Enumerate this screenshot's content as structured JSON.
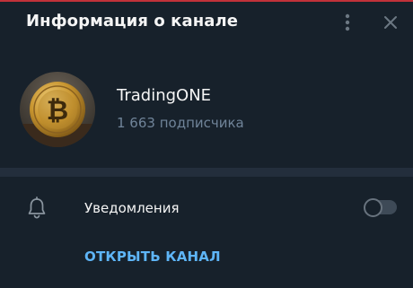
{
  "header": {
    "title": "Информация о канале",
    "menu_icon": "more-vertical-icon",
    "close_icon": "close-icon"
  },
  "channel": {
    "name": "TradingONE",
    "subscribers": "1 663 подписчика",
    "avatar_icon": "bitcoin-coin-avatar"
  },
  "notifications": {
    "label": "Уведомления",
    "icon": "bell-icon",
    "enabled": false
  },
  "actions": {
    "open_channel": "ОТКРЫТЬ КАНАЛ"
  },
  "colors": {
    "background": "#17212b",
    "divider": "#232e3c",
    "accent": "#5eb5f7",
    "muted": "#708499",
    "top_line": "#c2323a"
  }
}
